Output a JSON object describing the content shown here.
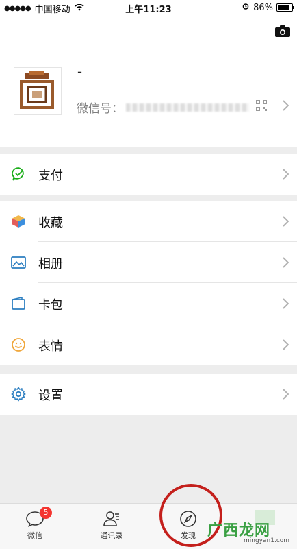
{
  "status_bar": {
    "carrier": "中国移动",
    "time": "上午11:23",
    "battery": "86%",
    "battery_level": 0.86
  },
  "profile": {
    "nickname": "ˉ",
    "wechat_id_label": "微信号："
  },
  "menu": {
    "pay": "支付",
    "favorites": "收藏",
    "album": "相册",
    "cards": "卡包",
    "stickers": "表情",
    "settings": "设置"
  },
  "tabbar": {
    "chats": "微信",
    "chats_badge": "5",
    "contacts": "通讯录",
    "discover": "发现"
  },
  "watermark": {
    "logo": "广西龙网",
    "url": "mingyan1.com"
  },
  "colors": {
    "accent_green": "#1aad19",
    "badge_red": "#f43530",
    "circle_red": "#c4201c"
  }
}
